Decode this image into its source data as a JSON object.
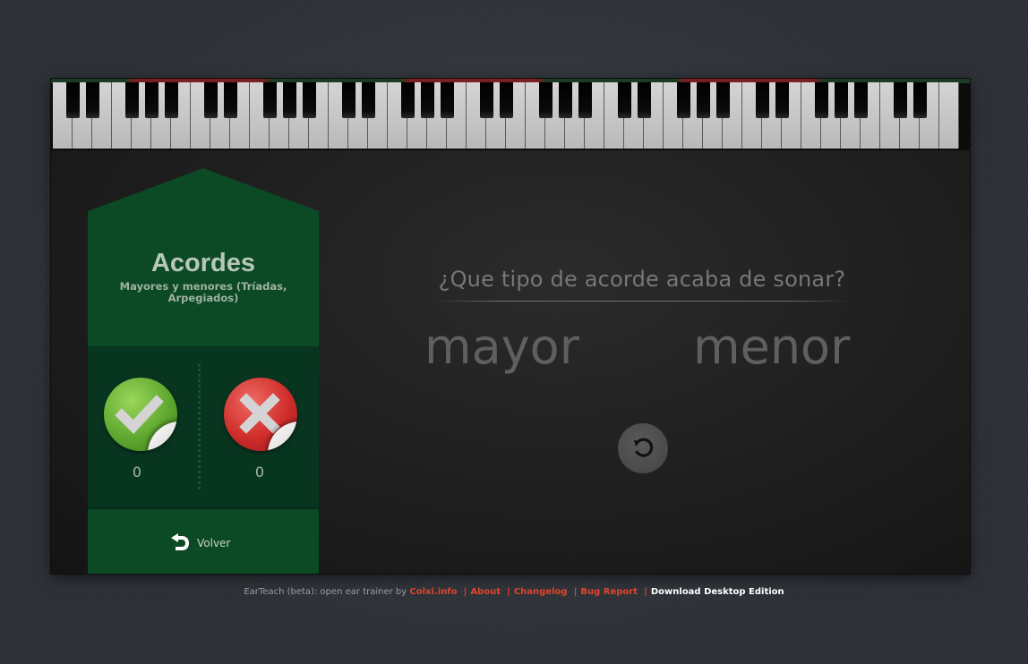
{
  "app": {
    "panel": {
      "title": "Acordes",
      "subtitle": "Mayores y menores (Tríadas, Arpegiados)",
      "correct_icon": "check-icon",
      "wrong_icon": "cross-icon",
      "correct_count": "0",
      "wrong_count": "0",
      "back_icon": "undo-arrow-icon",
      "back_label": "Volver"
    },
    "question": "¿Que tipo de acorde acaba de sonar?",
    "answers": [
      "mayor",
      "menor"
    ],
    "replay_icon": "replay-icon",
    "colors": {
      "panel_green": "#0c4a25",
      "panel_dark_green": "#083520",
      "correct_badge": "#5fa830",
      "wrong_badge": "#cf2d2a",
      "link_red": "#e0442a"
    }
  },
  "footer": {
    "prefix": "EarTeach (beta): open ear trainer by",
    "links": [
      "Colxi.info",
      "About",
      "Changelog",
      "Bug Report"
    ],
    "separator": "|",
    "download": "Download Desktop Edition"
  }
}
